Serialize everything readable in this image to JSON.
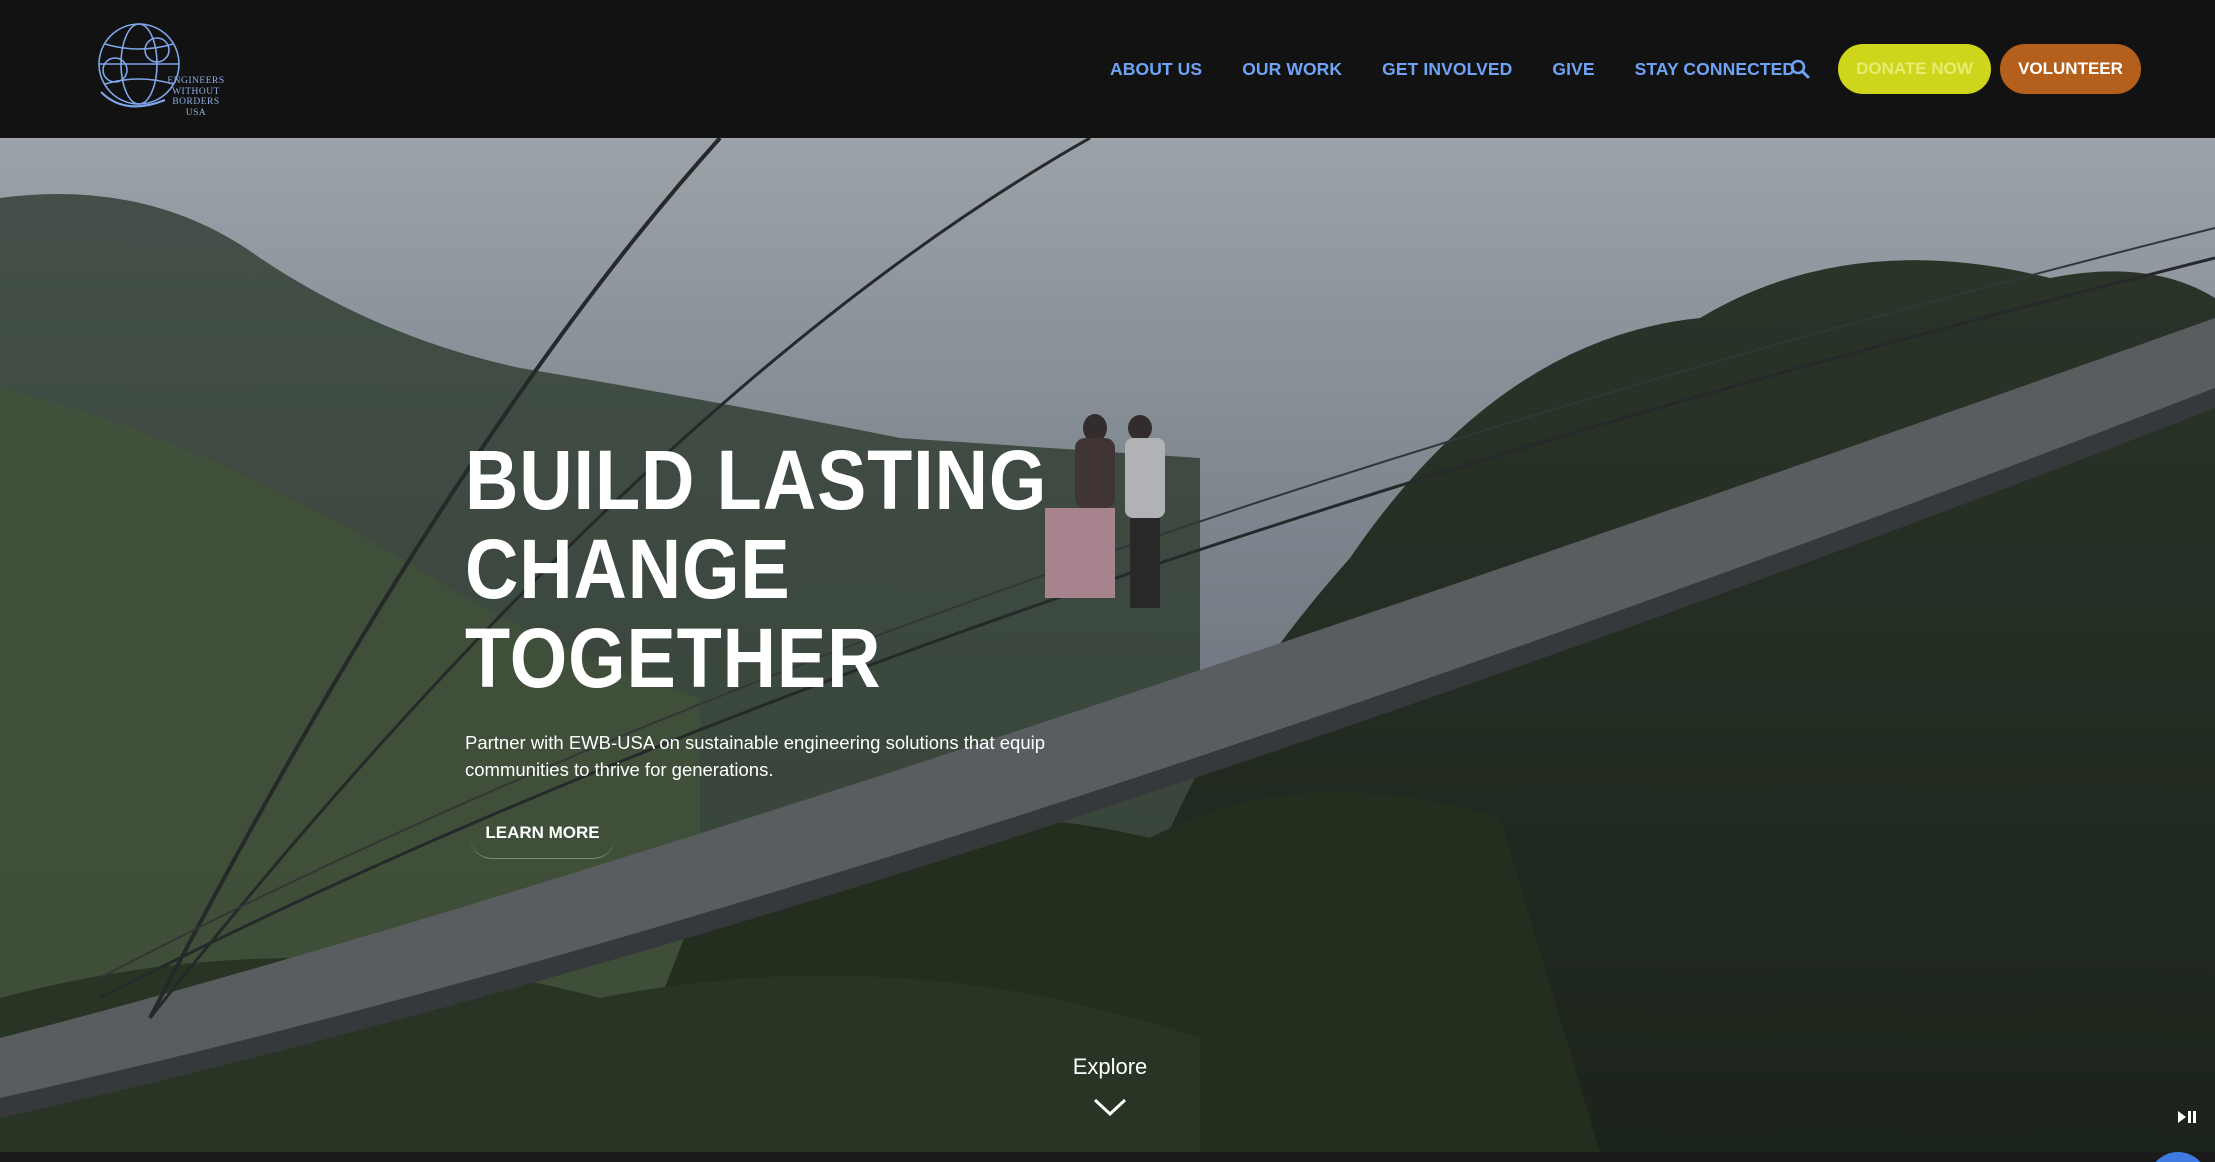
{
  "header": {
    "logo_text": [
      "ENGINEERS",
      "WITHOUT",
      "BORDERS",
      "USA"
    ],
    "nav": [
      {
        "label": "ABOUT US"
      },
      {
        "label": "OUR WORK"
      },
      {
        "label": "GET INVOLVED"
      },
      {
        "label": "GIVE"
      },
      {
        "label": "STAY CONNECTED"
      }
    ],
    "search_icon": "search-icon",
    "donate_label": "DONATE NOW",
    "volunteer_label": "VOLUNTEER"
  },
  "hero": {
    "title_lines": [
      "BUILD LASTING",
      "CHANGE",
      "TOGETHER"
    ],
    "subtitle": "Partner with EWB-USA on sustainable engineering solutions that equip communities to thrive for generations.",
    "cta_label": "LEARN MORE",
    "explore_label": "Explore",
    "explore_icon": "chevron-down-icon",
    "video_control_icon": "play-pause-icon"
  },
  "colors": {
    "header_bg": "#121212",
    "nav_link": "#6fa3f5",
    "donate_bg": "#cfd51a",
    "volunteer_bg": "#b4601c",
    "hero_text": "#ffffff"
  }
}
